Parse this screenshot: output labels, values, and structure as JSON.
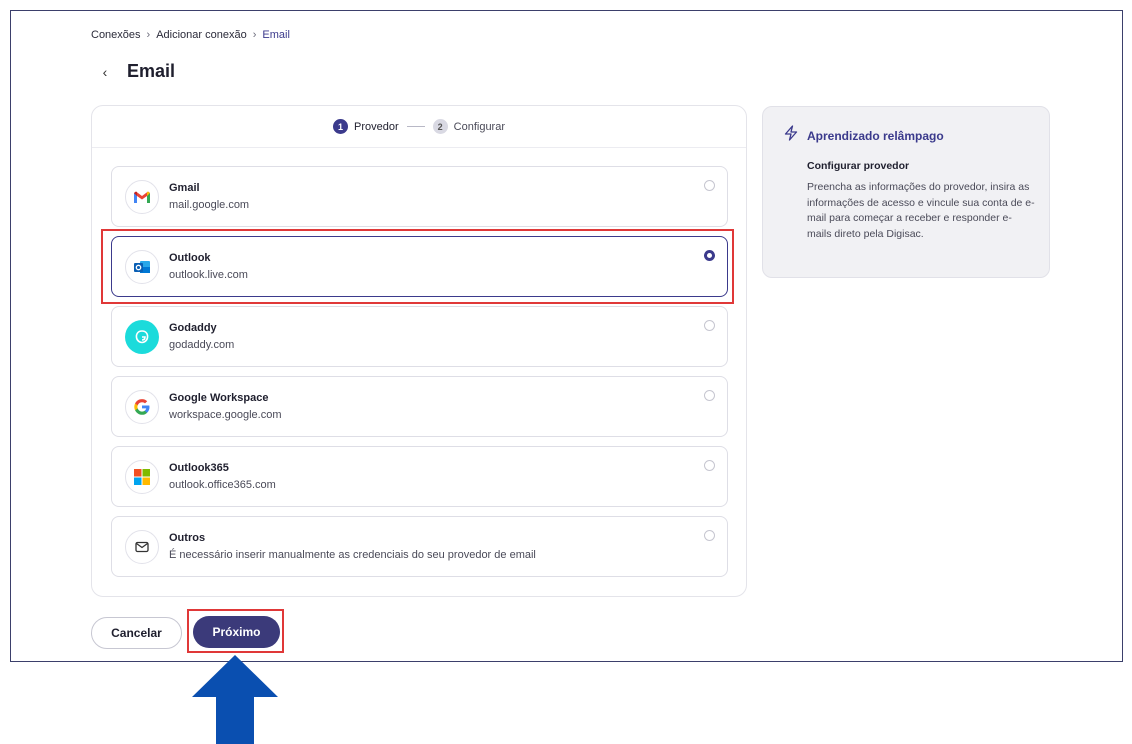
{
  "breadcrumb": {
    "items": [
      "Conexões",
      "Adicionar conexão",
      "Email"
    ],
    "separator": "›"
  },
  "page": {
    "title": "Email",
    "back_glyph": "‹"
  },
  "stepper": {
    "steps": [
      {
        "number": "1",
        "label": "Provedor",
        "state": "active"
      },
      {
        "number": "2",
        "label": "Configurar",
        "state": "inactive"
      }
    ]
  },
  "providers": [
    {
      "name": "Gmail",
      "domain": "mail.google.com",
      "icon": "gmail-icon",
      "selected": false
    },
    {
      "name": "Outlook",
      "domain": "outlook.live.com",
      "icon": "outlook-icon",
      "selected": true
    },
    {
      "name": "Godaddy",
      "domain": "godaddy.com",
      "icon": "godaddy-icon",
      "selected": false
    },
    {
      "name": "Google Workspace",
      "domain": "workspace.google.com",
      "icon": "google-icon",
      "selected": false
    },
    {
      "name": "Outlook365",
      "domain": "outlook.office365.com",
      "icon": "microsoft-icon",
      "selected": false
    },
    {
      "name": "Outros",
      "domain": "É necessário inserir manualmente as credenciais do seu provedor de email",
      "icon": "envelope-icon",
      "selected": false
    }
  ],
  "side_panel": {
    "title": "Aprendizado relâmpago",
    "icon": "lightning-icon",
    "subtitle": "Configurar provedor",
    "body": "Preencha as informações do provedor, insira as informações de acesso e vincule sua conta de e-mail para começar a receber e responder e-mails direto pela Digisac."
  },
  "buttons": {
    "cancel_label": "Cancelar",
    "next_label": "Próximo"
  },
  "colors": {
    "accent": "#3b3a8c",
    "annotation_red": "#e03838",
    "annotation_arrow": "#0a4fb0"
  }
}
